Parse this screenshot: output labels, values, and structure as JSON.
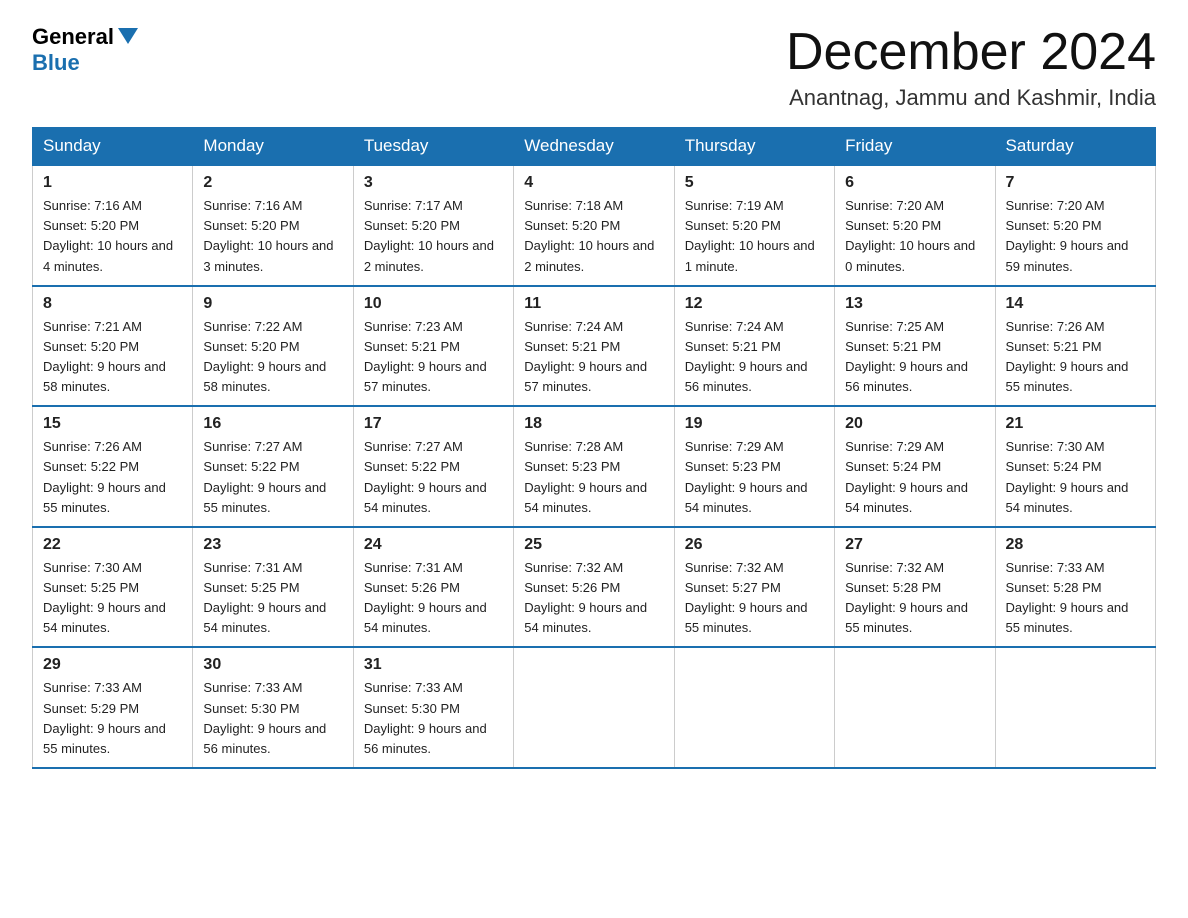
{
  "logo": {
    "general": "General",
    "blue": "Blue"
  },
  "title": "December 2024",
  "location": "Anantnag, Jammu and Kashmir, India",
  "weekdays": [
    "Sunday",
    "Monday",
    "Tuesday",
    "Wednesday",
    "Thursday",
    "Friday",
    "Saturday"
  ],
  "weeks": [
    [
      {
        "day": "1",
        "sunrise": "7:16 AM",
        "sunset": "5:20 PM",
        "daylight": "10 hours and 4 minutes."
      },
      {
        "day": "2",
        "sunrise": "7:16 AM",
        "sunset": "5:20 PM",
        "daylight": "10 hours and 3 minutes."
      },
      {
        "day": "3",
        "sunrise": "7:17 AM",
        "sunset": "5:20 PM",
        "daylight": "10 hours and 2 minutes."
      },
      {
        "day": "4",
        "sunrise": "7:18 AM",
        "sunset": "5:20 PM",
        "daylight": "10 hours and 2 minutes."
      },
      {
        "day": "5",
        "sunrise": "7:19 AM",
        "sunset": "5:20 PM",
        "daylight": "10 hours and 1 minute."
      },
      {
        "day": "6",
        "sunrise": "7:20 AM",
        "sunset": "5:20 PM",
        "daylight": "10 hours and 0 minutes."
      },
      {
        "day": "7",
        "sunrise": "7:20 AM",
        "sunset": "5:20 PM",
        "daylight": "9 hours and 59 minutes."
      }
    ],
    [
      {
        "day": "8",
        "sunrise": "7:21 AM",
        "sunset": "5:20 PM",
        "daylight": "9 hours and 58 minutes."
      },
      {
        "day": "9",
        "sunrise": "7:22 AM",
        "sunset": "5:20 PM",
        "daylight": "9 hours and 58 minutes."
      },
      {
        "day": "10",
        "sunrise": "7:23 AM",
        "sunset": "5:21 PM",
        "daylight": "9 hours and 57 minutes."
      },
      {
        "day": "11",
        "sunrise": "7:24 AM",
        "sunset": "5:21 PM",
        "daylight": "9 hours and 57 minutes."
      },
      {
        "day": "12",
        "sunrise": "7:24 AM",
        "sunset": "5:21 PM",
        "daylight": "9 hours and 56 minutes."
      },
      {
        "day": "13",
        "sunrise": "7:25 AM",
        "sunset": "5:21 PM",
        "daylight": "9 hours and 56 minutes."
      },
      {
        "day": "14",
        "sunrise": "7:26 AM",
        "sunset": "5:21 PM",
        "daylight": "9 hours and 55 minutes."
      }
    ],
    [
      {
        "day": "15",
        "sunrise": "7:26 AM",
        "sunset": "5:22 PM",
        "daylight": "9 hours and 55 minutes."
      },
      {
        "day": "16",
        "sunrise": "7:27 AM",
        "sunset": "5:22 PM",
        "daylight": "9 hours and 55 minutes."
      },
      {
        "day": "17",
        "sunrise": "7:27 AM",
        "sunset": "5:22 PM",
        "daylight": "9 hours and 54 minutes."
      },
      {
        "day": "18",
        "sunrise": "7:28 AM",
        "sunset": "5:23 PM",
        "daylight": "9 hours and 54 minutes."
      },
      {
        "day": "19",
        "sunrise": "7:29 AM",
        "sunset": "5:23 PM",
        "daylight": "9 hours and 54 minutes."
      },
      {
        "day": "20",
        "sunrise": "7:29 AM",
        "sunset": "5:24 PM",
        "daylight": "9 hours and 54 minutes."
      },
      {
        "day": "21",
        "sunrise": "7:30 AM",
        "sunset": "5:24 PM",
        "daylight": "9 hours and 54 minutes."
      }
    ],
    [
      {
        "day": "22",
        "sunrise": "7:30 AM",
        "sunset": "5:25 PM",
        "daylight": "9 hours and 54 minutes."
      },
      {
        "day": "23",
        "sunrise": "7:31 AM",
        "sunset": "5:25 PM",
        "daylight": "9 hours and 54 minutes."
      },
      {
        "day": "24",
        "sunrise": "7:31 AM",
        "sunset": "5:26 PM",
        "daylight": "9 hours and 54 minutes."
      },
      {
        "day": "25",
        "sunrise": "7:32 AM",
        "sunset": "5:26 PM",
        "daylight": "9 hours and 54 minutes."
      },
      {
        "day": "26",
        "sunrise": "7:32 AM",
        "sunset": "5:27 PM",
        "daylight": "9 hours and 55 minutes."
      },
      {
        "day": "27",
        "sunrise": "7:32 AM",
        "sunset": "5:28 PM",
        "daylight": "9 hours and 55 minutes."
      },
      {
        "day": "28",
        "sunrise": "7:33 AM",
        "sunset": "5:28 PM",
        "daylight": "9 hours and 55 minutes."
      }
    ],
    [
      {
        "day": "29",
        "sunrise": "7:33 AM",
        "sunset": "5:29 PM",
        "daylight": "9 hours and 55 minutes."
      },
      {
        "day": "30",
        "sunrise": "7:33 AM",
        "sunset": "5:30 PM",
        "daylight": "9 hours and 56 minutes."
      },
      {
        "day": "31",
        "sunrise": "7:33 AM",
        "sunset": "5:30 PM",
        "daylight": "9 hours and 56 minutes."
      },
      null,
      null,
      null,
      null
    ]
  ]
}
